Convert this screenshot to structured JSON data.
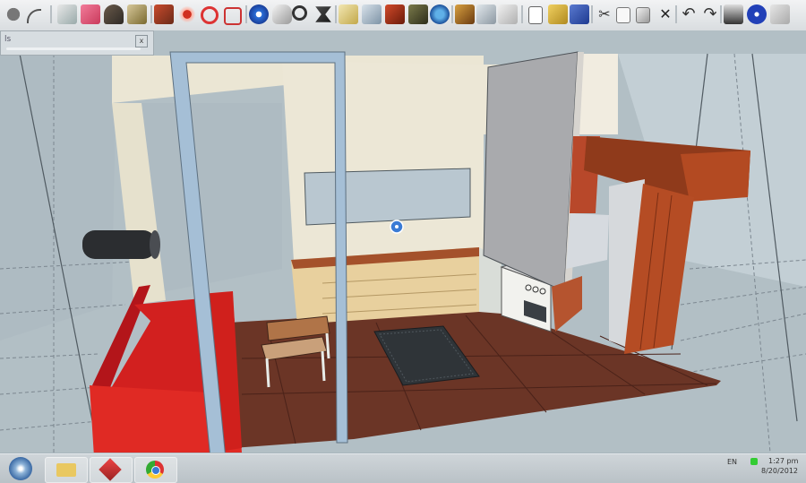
{
  "window": {
    "tray_title": "ls",
    "tray_close_glyph": "x"
  },
  "toolbar_icons": [
    "orbit-circle-icon",
    "arc-icon",
    "push-pull-icon",
    "eraser-icon",
    "paint-bucket-icon",
    "push-pull-block-icon",
    "follow-me-icon",
    "move-icon",
    "rotate-icon",
    "offset-icon",
    "orbit-icon",
    "pan-icon",
    "zoom-icon",
    "zoom-extents-icon",
    "warehouse-icon",
    "share-model-icon",
    "components-icon",
    "geolocation-icon",
    "section-plane-icon",
    "styles-icon",
    "new-file-icon",
    "open-file-icon",
    "save-icon",
    "cut-icon",
    "copy-icon",
    "paste-icon",
    "delete-icon",
    "undo-icon",
    "redo-icon",
    "print-icon",
    "info-icon"
  ],
  "taskbar": {
    "apps": [
      "start-orb-icon",
      "file-explorer-icon",
      "sketchup-icon",
      "chrome-icon"
    ],
    "language": "EN",
    "clock_time": "1:27 pm",
    "clock_date": "8/20/2012"
  },
  "colors": {
    "sofa_red": "#d2201f",
    "floor_brown": "#6b3526",
    "wall_cream": "#ece7d6",
    "cabinet_wood": "#e9d19f",
    "beam_wood": "#9a3e1e",
    "frame_blue": "#a5bfd6"
  }
}
